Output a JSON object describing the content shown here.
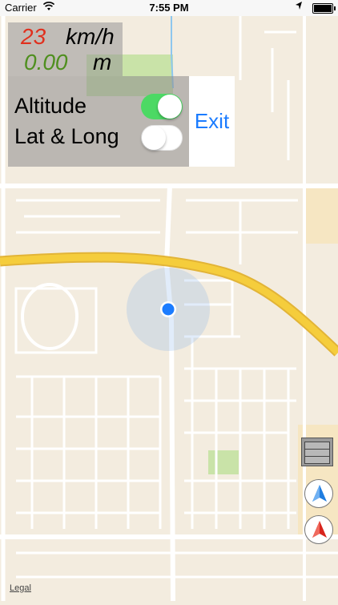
{
  "status_bar": {
    "carrier": "Carrier",
    "time": "7:55 PM",
    "wifi_icon": "wifi-icon",
    "location_icon": "location-arrow-icon",
    "battery_level": 1.0
  },
  "speed_panel": {
    "speed_value": "23",
    "speed_unit": "km/h",
    "distance_value": "0.00",
    "distance_unit": "m",
    "colors": {
      "speed": "#e0301e",
      "distance": "#4f8f1f"
    }
  },
  "toggles": [
    {
      "label": "Altitude",
      "on": true
    },
    {
      "label": "Lat & Long",
      "on": false
    }
  ],
  "exit_button": {
    "label": "Exit",
    "color": "#1b7cff"
  },
  "map": {
    "legal_link": "Legal",
    "user_location_icon": "user-location-dot-icon",
    "layers_icon": "map-layers-icon",
    "north_compass_icon": "compass-north-blue-icon",
    "heading_compass_icon": "compass-heading-red-icon",
    "highway_color": "#f5cd3c"
  }
}
